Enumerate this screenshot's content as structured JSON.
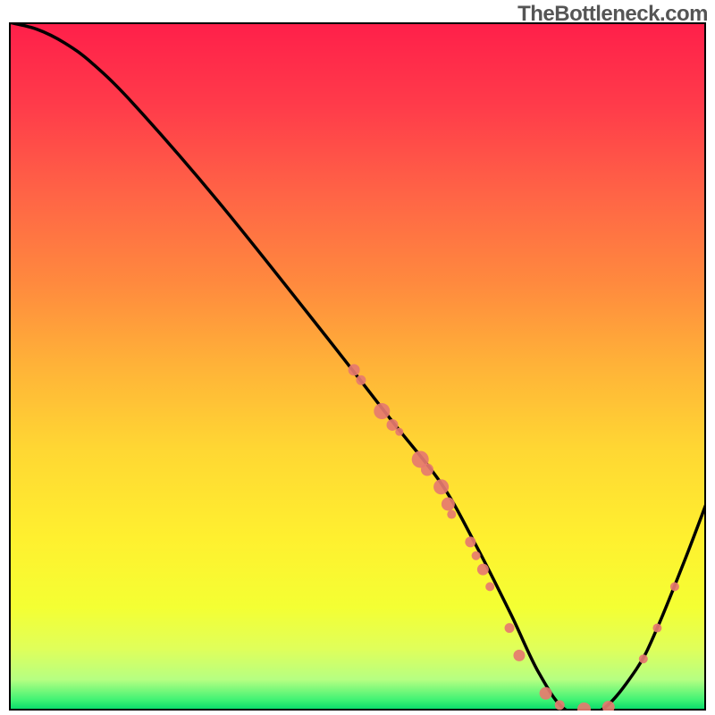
{
  "watermark": "TheBottleneck.com",
  "chart_data": {
    "type": "line",
    "title": "",
    "xlabel": "",
    "ylabel": "",
    "xlim": [
      0,
      100
    ],
    "ylim": [
      0,
      100
    ],
    "series": [
      {
        "name": "bottleneck-curve",
        "x": [
          0,
          4,
          8,
          12,
          18,
          30,
          45,
          55,
          62,
          67,
          72,
          76,
          80,
          85,
          90,
          93,
          97,
          100
        ],
        "y": [
          100,
          99,
          97,
          94,
          88,
          74,
          55,
          42,
          33,
          24,
          14,
          5.5,
          0,
          0.1,
          6,
          12,
          22,
          30
        ]
      }
    ],
    "markers": {
      "name": "highlighted-points",
      "color": "#e67a6f",
      "points": [
        {
          "x": 49.5,
          "y": 49.5,
          "r": 6.5
        },
        {
          "x": 50.5,
          "y": 48.0,
          "r": 5.5
        },
        {
          "x": 53.5,
          "y": 43.5,
          "r": 9.0
        },
        {
          "x": 55.0,
          "y": 41.5,
          "r": 6.5
        },
        {
          "x": 56.0,
          "y": 40.5,
          "r": 4.5
        },
        {
          "x": 59.0,
          "y": 36.5,
          "r": 9.5
        },
        {
          "x": 60.0,
          "y": 35.0,
          "r": 7.0
        },
        {
          "x": 62.0,
          "y": 32.5,
          "r": 8.5
        },
        {
          "x": 63.0,
          "y": 30.0,
          "r": 7.5
        },
        {
          "x": 63.5,
          "y": 28.5,
          "r": 5.0
        },
        {
          "x": 66.2,
          "y": 24.5,
          "r": 6.0
        },
        {
          "x": 67.0,
          "y": 22.5,
          "r": 5.0
        },
        {
          "x": 68.0,
          "y": 20.5,
          "r": 6.5
        },
        {
          "x": 69.0,
          "y": 18.0,
          "r": 5.0
        },
        {
          "x": 71.8,
          "y": 12.0,
          "r": 5.5
        },
        {
          "x": 73.2,
          "y": 8.0,
          "r": 6.5
        },
        {
          "x": 77.0,
          "y": 2.5,
          "r": 7.0
        },
        {
          "x": 79.0,
          "y": 0.8,
          "r": 5.5
        },
        {
          "x": 82.5,
          "y": 0.2,
          "r": 7.5
        },
        {
          "x": 86.0,
          "y": 0.5,
          "r": 7.0
        },
        {
          "x": 91.0,
          "y": 7.5,
          "r": 5.0
        },
        {
          "x": 93.0,
          "y": 12.0,
          "r": 5.0
        },
        {
          "x": 95.5,
          "y": 18.0,
          "r": 5.0
        }
      ]
    },
    "gradient_stops": [
      {
        "offset": 0.0,
        "color": "#ff1f4a"
      },
      {
        "offset": 0.12,
        "color": "#ff3b4a"
      },
      {
        "offset": 0.25,
        "color": "#ff6446"
      },
      {
        "offset": 0.38,
        "color": "#ff8a3e"
      },
      {
        "offset": 0.5,
        "color": "#ffb338"
      },
      {
        "offset": 0.62,
        "color": "#ffd733"
      },
      {
        "offset": 0.75,
        "color": "#fff02f"
      },
      {
        "offset": 0.85,
        "color": "#f4ff33"
      },
      {
        "offset": 0.91,
        "color": "#e0ff5a"
      },
      {
        "offset": 0.955,
        "color": "#b6ff82"
      },
      {
        "offset": 0.985,
        "color": "#3ef274"
      },
      {
        "offset": 1.0,
        "color": "#00d96a"
      }
    ],
    "grid": false,
    "legend": false
  }
}
